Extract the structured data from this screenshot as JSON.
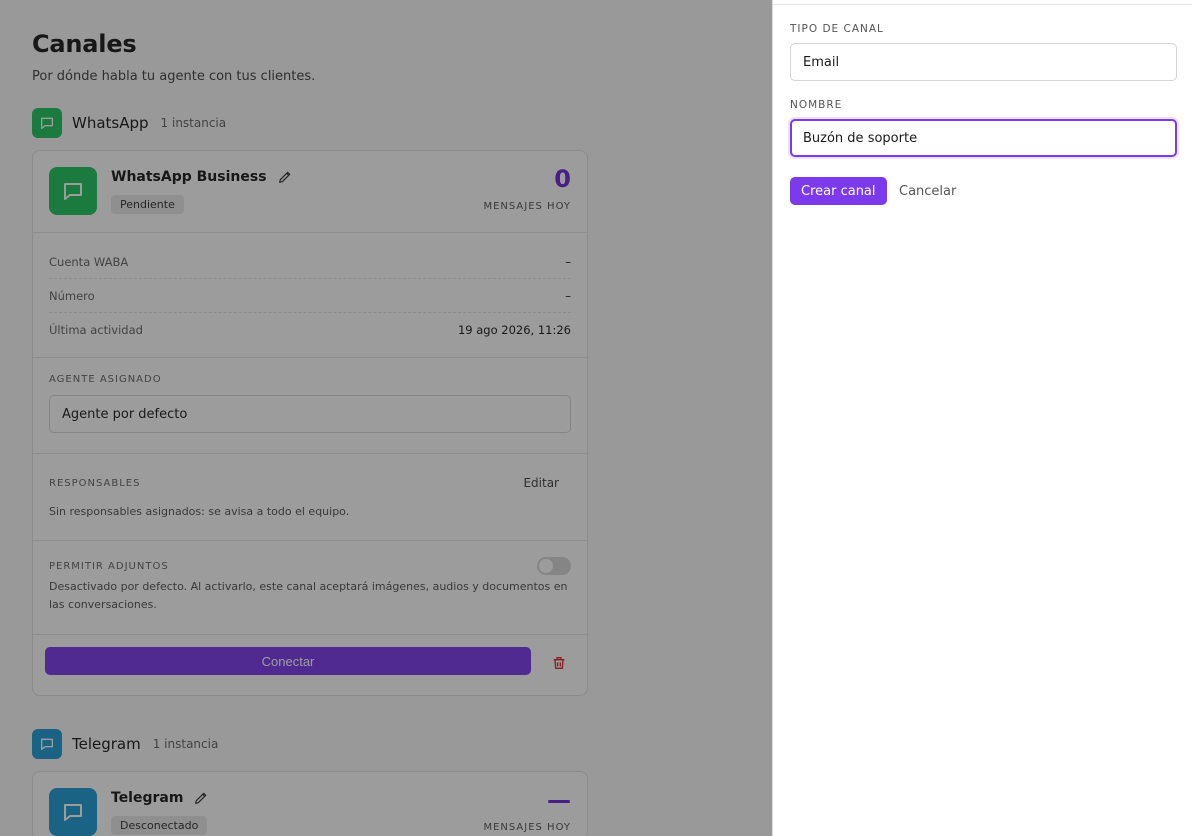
{
  "page": {
    "title": "Canales",
    "subtitle": "Por dónde habla tu agente con tus clientes."
  },
  "colors": {
    "accent": "#7c3aed",
    "whatsapp": "#22c55e",
    "telegram": "#1f9ed8",
    "danger": "#dc2626"
  },
  "sections": [
    {
      "name": "WhatsApp",
      "count": "1 instancia",
      "card": {
        "name": "WhatsApp Business",
        "status": "Pendiente",
        "messages_today": "0",
        "messages_label": "MENSAJES HOY",
        "details": [
          {
            "key": "Cuenta WABA",
            "value": "–"
          },
          {
            "key": "Número",
            "value": "–"
          },
          {
            "key": "Última actividad",
            "value": "19 ago 2026, 11:26"
          }
        ],
        "agent_label": "AGENTE ASIGNADO",
        "agent_value": "Agente por defecto",
        "owners_label": "RESPONSABLES",
        "owners_edit": "Editar",
        "owners_text": "Sin responsables asignados: se avisa a todo el equipo.",
        "attachments_label": "PERMITIR ADJUNTOS",
        "attachments_text": "Desactivado por defecto. Al activarlo, este canal aceptará imágenes, audios y documentos en las conversaciones.",
        "attachments_enabled": false,
        "connect_label": "Conectar"
      }
    },
    {
      "name": "Telegram",
      "count": "1 instancia",
      "card": {
        "name": "Telegram",
        "status": "Desconectado",
        "messages_today": "—",
        "messages_label": "MENSAJES HOY"
      }
    }
  ],
  "panel": {
    "type_label": "TIPO DE CANAL",
    "type_value": "Email",
    "name_label": "NOMBRE",
    "name_value": "Buzón de soporte",
    "create_label": "Crear canal",
    "cancel_label": "Cancelar"
  }
}
